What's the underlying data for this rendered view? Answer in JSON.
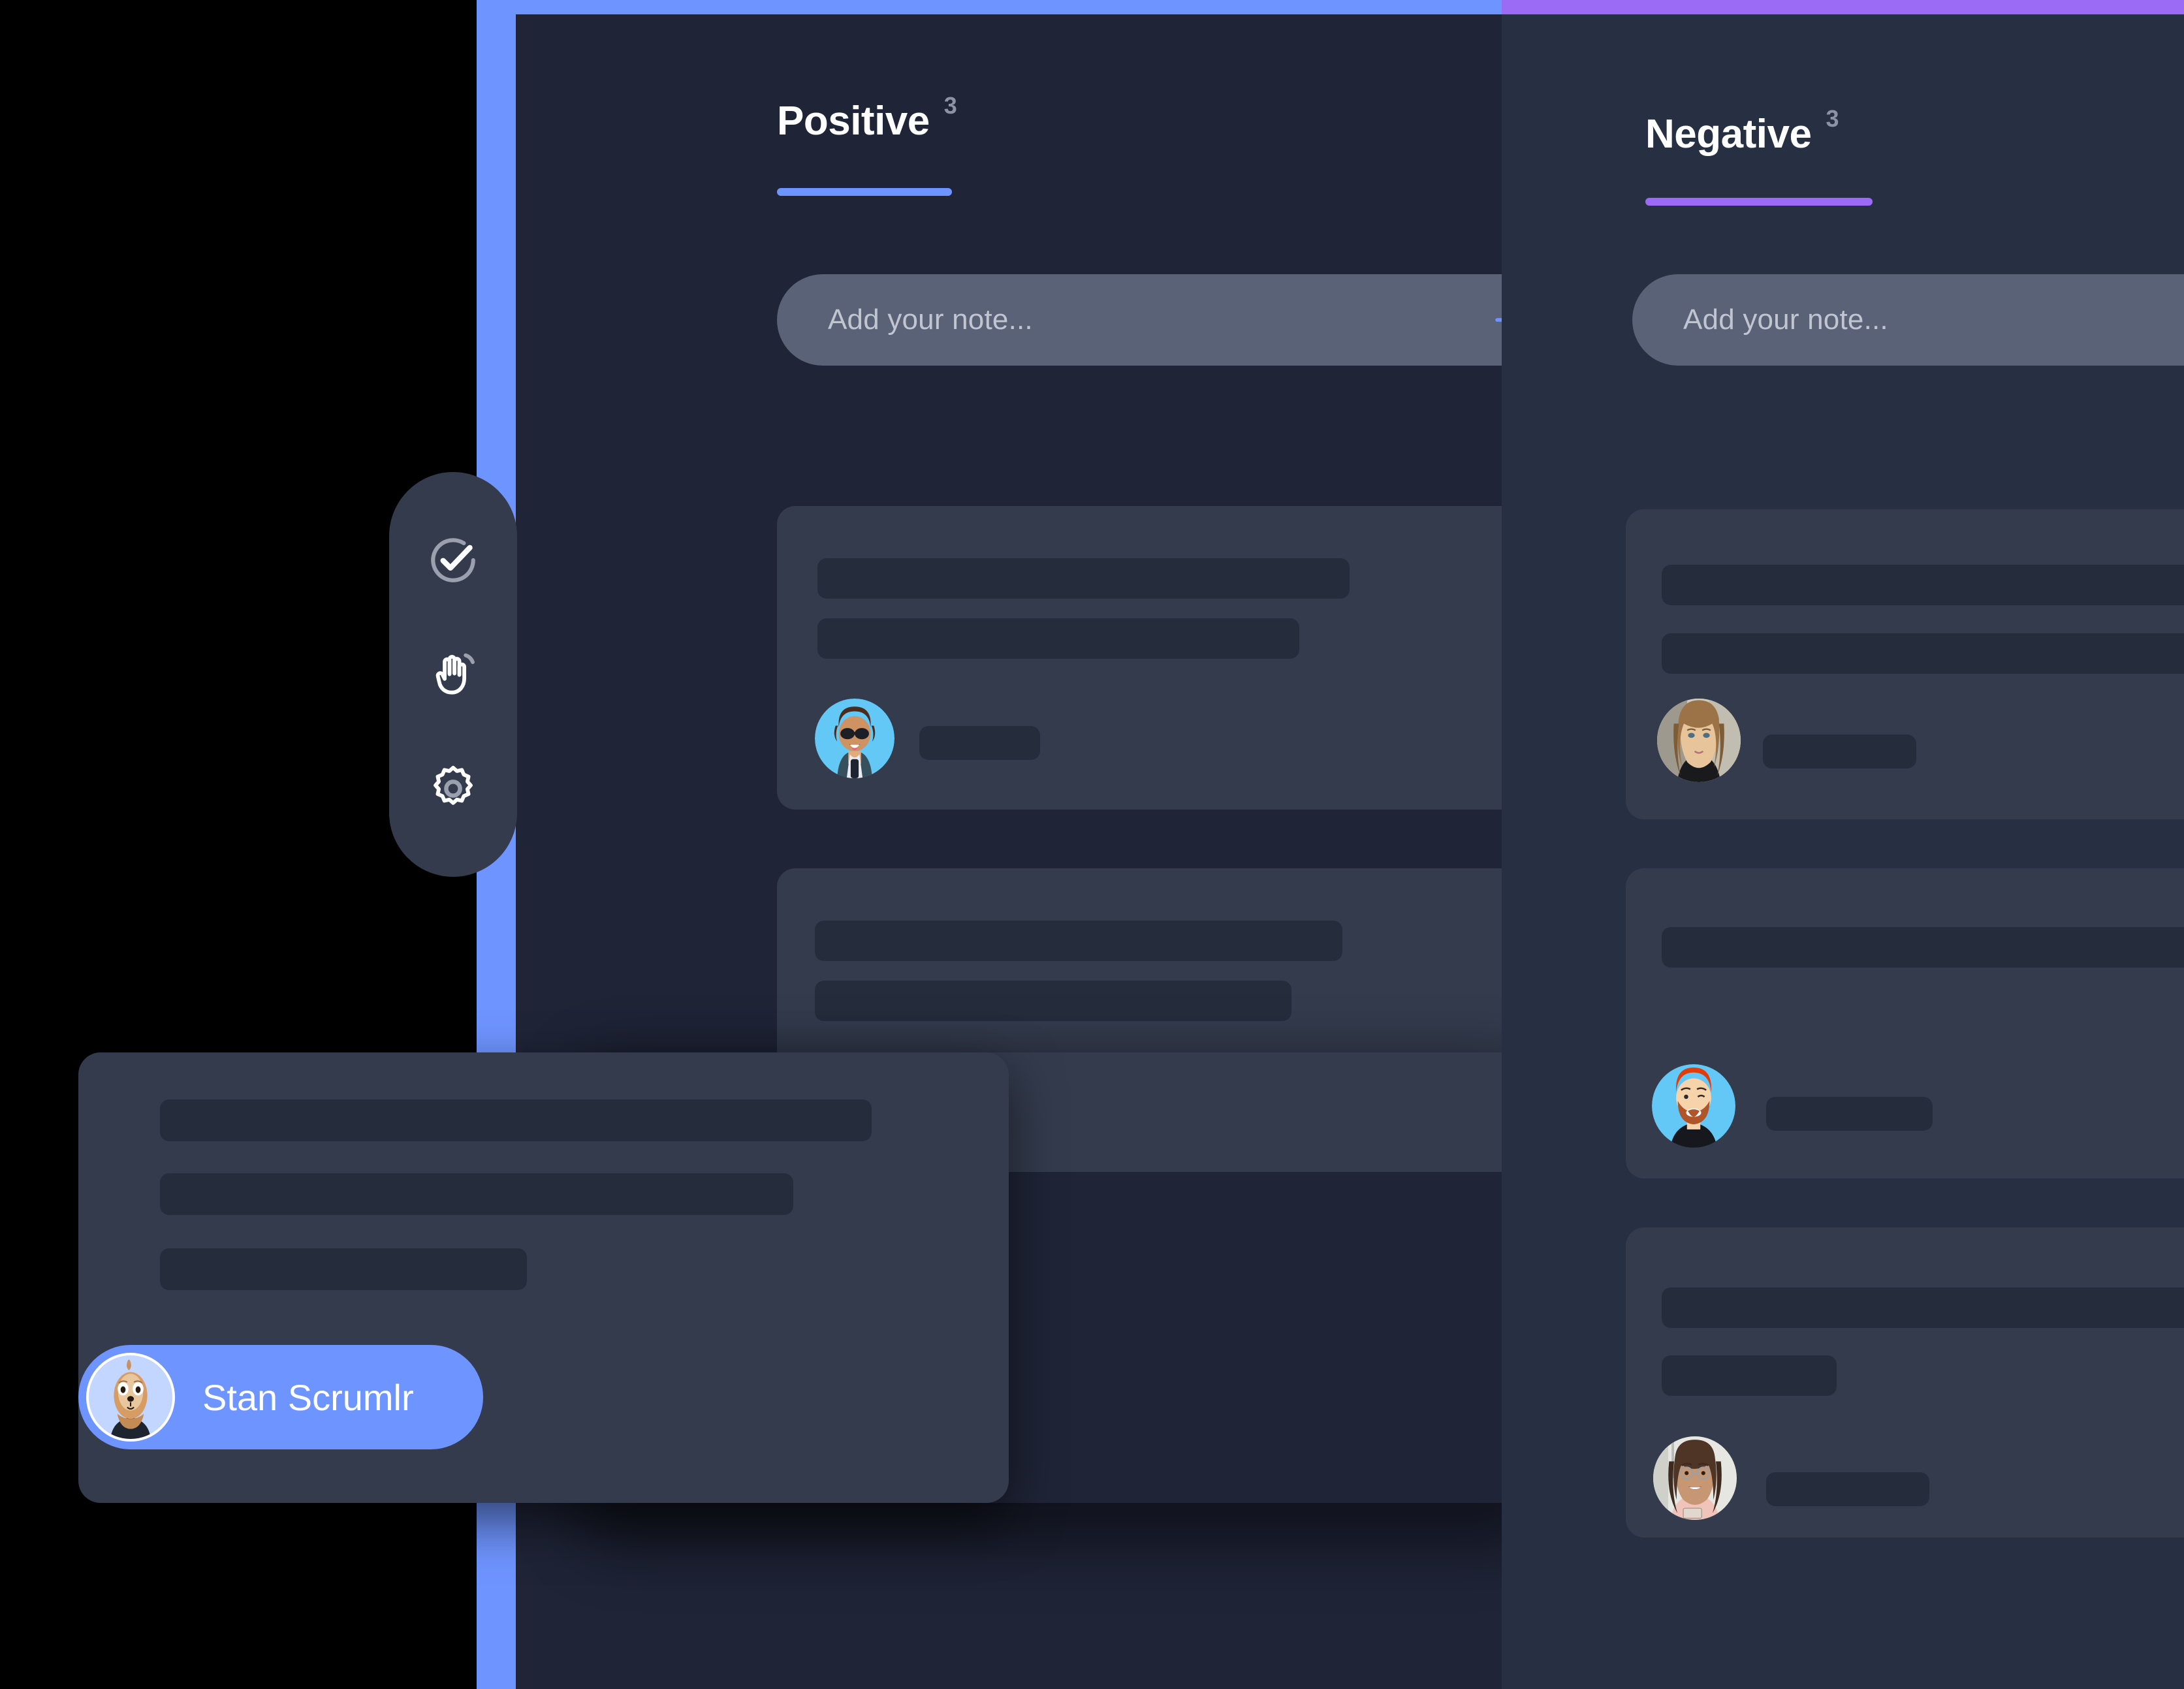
{
  "board": {
    "columns": [
      {
        "id": "positive",
        "title": "Positive",
        "count": "3",
        "accent_color": "#6e94ff",
        "background": "#1f2437",
        "add_note": {
          "placeholder": "Add your note...",
          "add_icon": "plus-icon"
        },
        "notes": [
          {
            "avatar": "avatar-sunglasses-man",
            "lines": [
              72,
              57
            ],
            "footer_line": 28
          },
          {
            "avatar": "",
            "lines": [
              71,
              56
            ],
            "footer_line": 0
          }
        ]
      },
      {
        "id": "negative",
        "title": "Negative",
        "count": "3",
        "accent_color": "#9b6bf5",
        "background": "#272f42",
        "add_note": {
          "placeholder": "Add your note...",
          "add_icon": ""
        },
        "notes": [
          {
            "avatar": "avatar-blonde-woman-photo",
            "lines": [
              95,
              85
            ],
            "footer_line": 30
          },
          {
            "avatar": "avatar-redhead-bearded-man",
            "lines": [
              95
            ],
            "footer_line": 33
          },
          {
            "avatar": "avatar-smiling-woman-glasses-photo",
            "lines": [
              95,
              27
            ],
            "footer_line": 26
          }
        ]
      }
    ]
  },
  "dragged_note": {
    "lines": [
      79,
      68,
      40
    ],
    "author": {
      "name": "Stan Scrumlr",
      "avatar": "avatar-sloth-stan",
      "pill_color": "#6e94ff"
    }
  },
  "toolbar": {
    "buttons": [
      {
        "icon": "check-circle-icon",
        "label": "Mark as done"
      },
      {
        "icon": "raised-hand-icon",
        "label": "Raise hand"
      },
      {
        "icon": "gear-icon",
        "label": "Settings"
      }
    ]
  },
  "colors": {
    "page_background": "#000000",
    "positive_accent": "#6e94ff",
    "negative_accent": "#9b6bf5",
    "card_background": "#333b4d",
    "skeleton": "#252d3d",
    "input_background": "#5a6278",
    "placeholder_text": "#c0c5d0",
    "count_text": "#8c93a5"
  }
}
